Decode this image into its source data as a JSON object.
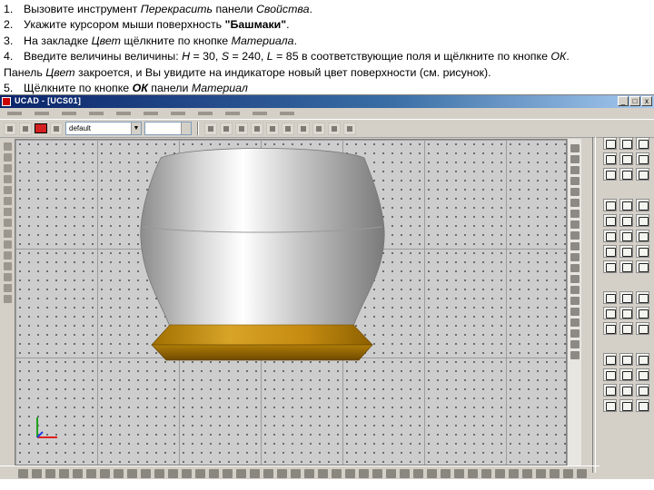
{
  "instructions": [
    {
      "num": "1.",
      "text": "Вызовите инструмент ",
      "italic": "Перекрасить",
      "text2": " панели ",
      "italic2": "Свойства",
      "text3": "."
    },
    {
      "num": "2.",
      "text": "Укажите курсором мыши поверхность ",
      "bold": "\"Башмаки\"",
      "text2": "."
    },
    {
      "num": "3.",
      "text": "На закладке ",
      "italic": "Цвет",
      "text2": " щёлкните по кнопке ",
      "italic2": "Материала",
      "text3": "."
    },
    {
      "num": "4.",
      "text": "Введите величины величины: ",
      "italic": "H",
      "text2": " = 30, ",
      "italic2": "S",
      "text3": " = 240, ",
      "italic3": "L",
      "text4": " = 85 в соответствующие поля и щёлкните по кнопке ",
      "italic4": "ОК",
      "text5": "."
    },
    {
      "num": "",
      "text": "Панель ",
      "italic": "Цвет",
      "text2": " закроется, и Вы увидите на индикаторе новый цвет поверхности (см. рисунок)."
    },
    {
      "num": "5.",
      "text": "Щёлкните по кнопке ",
      "bolditalic": "ОК",
      "text2": " панели ",
      "italic2": "Материал"
    }
  ],
  "window": {
    "title": "UCAD - [UCS01]",
    "minimize": "_",
    "maximize": "□",
    "close": "x"
  },
  "toolbar": {
    "layer_value": "default"
  },
  "colors": {
    "vase_body": "#c8c8c8",
    "vase_base": "#c88a10",
    "ucs_x": "#e02020",
    "ucs_y": "#20a020",
    "ucs_z": "#2040e0",
    "layer_color": "#d42020"
  },
  "icons": {
    "app_logo": "app-logo-icon",
    "ucs": "ucs-axis-icon"
  }
}
